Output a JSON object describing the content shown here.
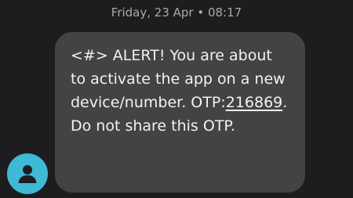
{
  "thread": {
    "timestamp": "Friday, 23 Apr • 08:17"
  },
  "message": {
    "text_before_otp": "<#> ALERT! You are about to activate the app on a new device/number. OTP:",
    "otp": "216869",
    "text_after_otp": ". Do not share this OTP."
  },
  "sender": {
    "avatar_icon": "person-icon",
    "avatar_color": "#3fb9d5"
  },
  "theme": {
    "background": "#1d1d1f",
    "bubble": "#434345",
    "text": "#f2f2f2",
    "timestamp_text": "#a9a9ad"
  }
}
